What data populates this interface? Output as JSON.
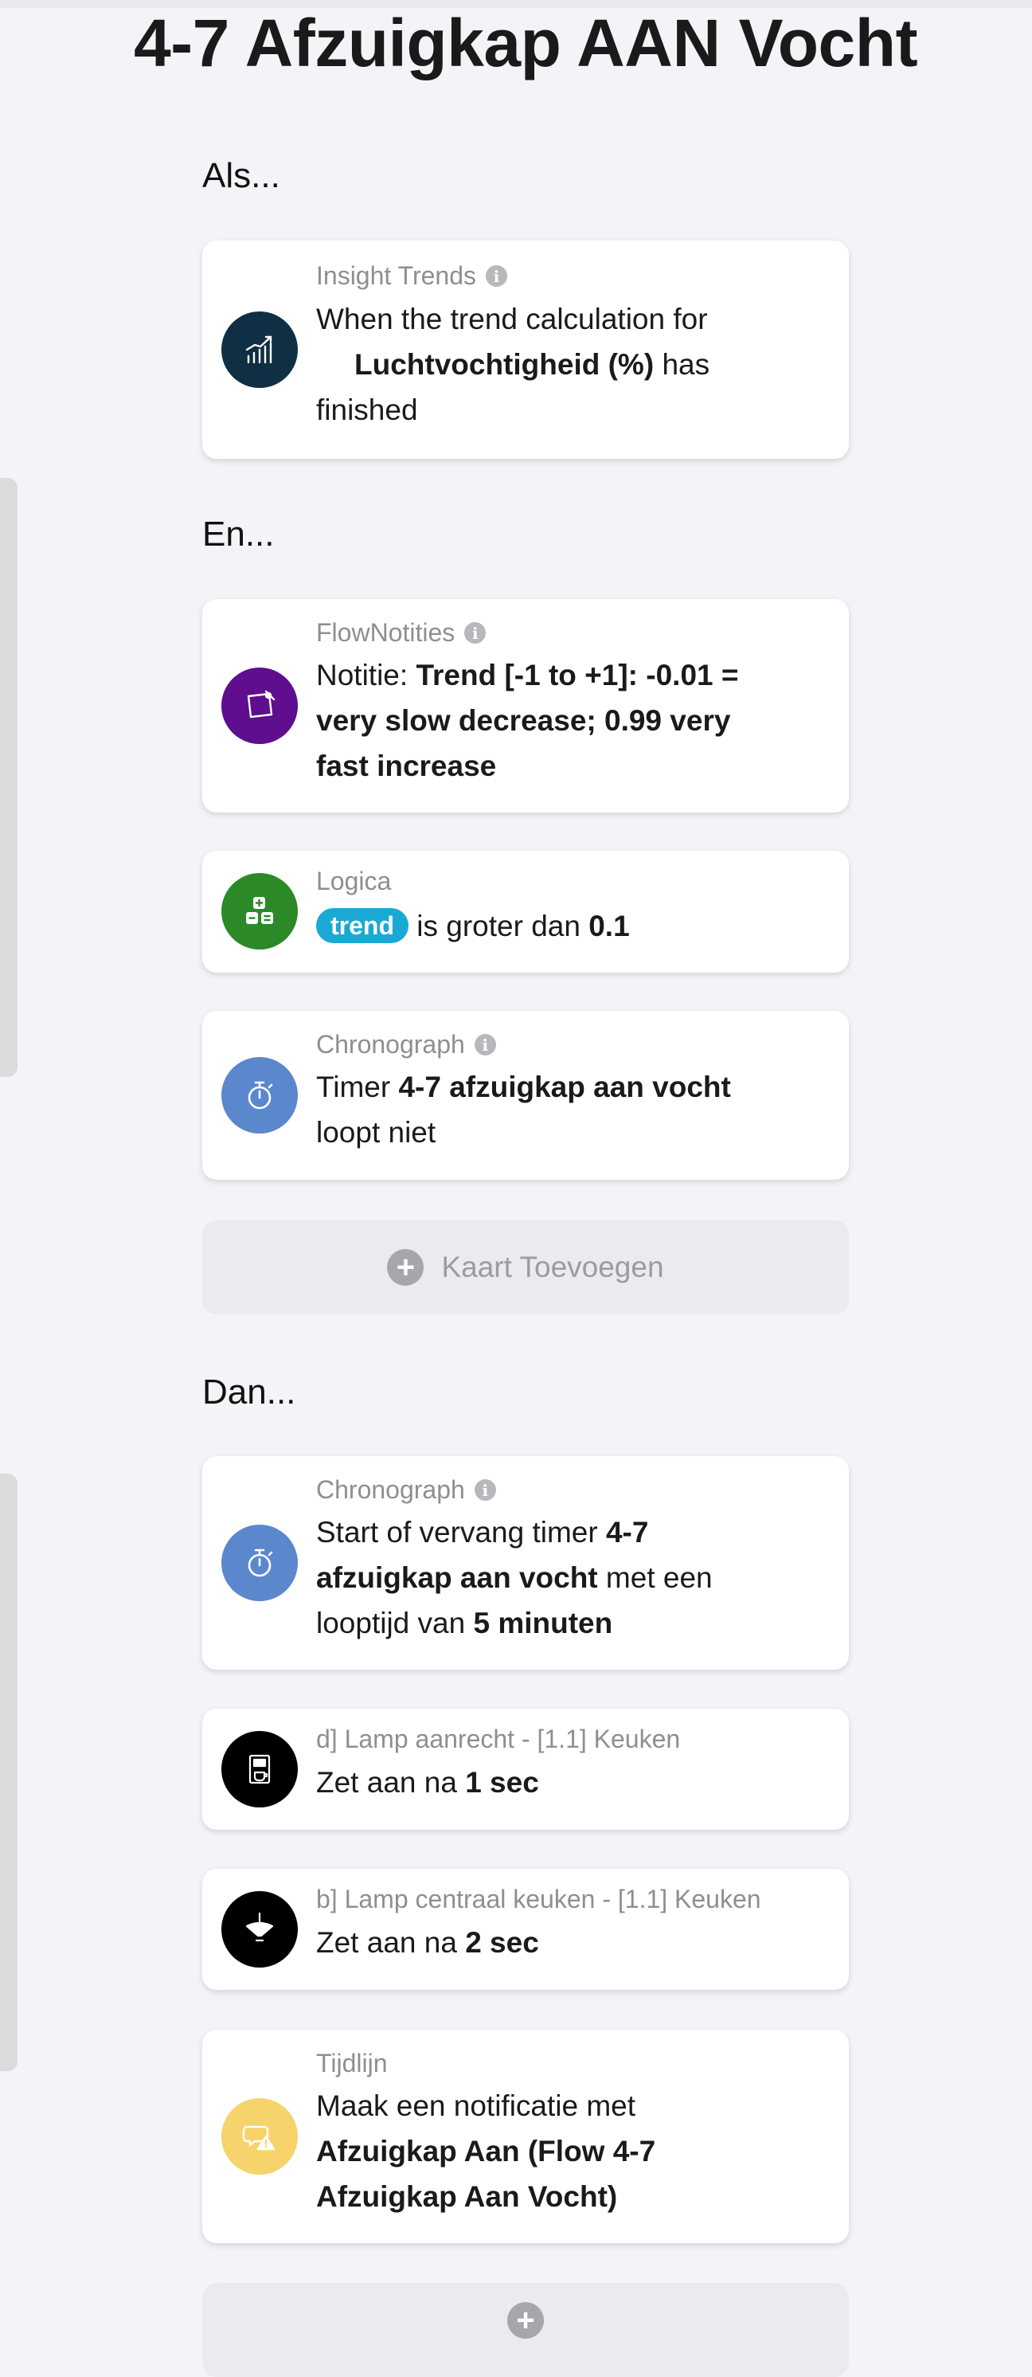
{
  "title": "4-7 Afzuigkap AAN Vocht",
  "sections": {
    "if": "Als...",
    "and": "En...",
    "then": "Dan..."
  },
  "cards": {
    "insight": {
      "source": "Insight Trends",
      "text1": "When the trend calculation for",
      "bold": "Luchtvochtigheid (%)",
      "text2": "has",
      "text3": "finished",
      "icon": "trend-chart-icon",
      "color": "#0f2f44"
    },
    "notes": {
      "source": "FlowNotities",
      "label": "Notitie:",
      "bold1": "Trend [-1 to +1]: -0.01 =",
      "bold2": "very slow decrease; 0.99 very",
      "bold3": "fast increase",
      "icon": "note-icon",
      "color": "#5e0e8e"
    },
    "logic": {
      "source": "Logica",
      "tag": "trend",
      "text": "is groter dan",
      "value": "0.1",
      "icon": "calculator-icon",
      "color": "#2b8a27"
    },
    "chrono_cond": {
      "source": "Chronograph",
      "label": "Timer",
      "bold": "4-7 afzuigkap aan vocht",
      "text": "loopt niet",
      "icon": "stopwatch-icon",
      "color": "#5b88cc"
    },
    "chrono_action": {
      "source": "Chronograph",
      "text1": "Start of vervang timer",
      "bold1": "4-7",
      "bold2": "afzuigkap aan vocht",
      "text2": "met een",
      "text3": "looptijd van",
      "bold3": "5",
      "bold4": "minuten",
      "icon": "stopwatch-icon",
      "color": "#5b88cc"
    },
    "lamp1": {
      "source": "d] Lamp aanrecht - [1.1] Keuken",
      "text": "Zet aan na",
      "bold": "1 sec",
      "icon": "coffee-machine-icon",
      "color": "#000000"
    },
    "lamp2": {
      "source": "b] Lamp centraal keuken - [1.1] Keuken",
      "text": "Zet aan na",
      "bold": "2 sec",
      "icon": "pendant-lamp-icon",
      "color": "#000000"
    },
    "timeline": {
      "source": "Tijdlijn",
      "text": "Maak een notificatie met",
      "bold1": "Afzuigkap Aan (Flow 4-7",
      "bold2": "Afzuigkap Aan Vocht)",
      "icon": "notification-warning-icon",
      "color": "#f6d36b"
    }
  },
  "add_card": {
    "label": "Kaart Toevoegen",
    "icon": "plus-circle-icon"
  }
}
